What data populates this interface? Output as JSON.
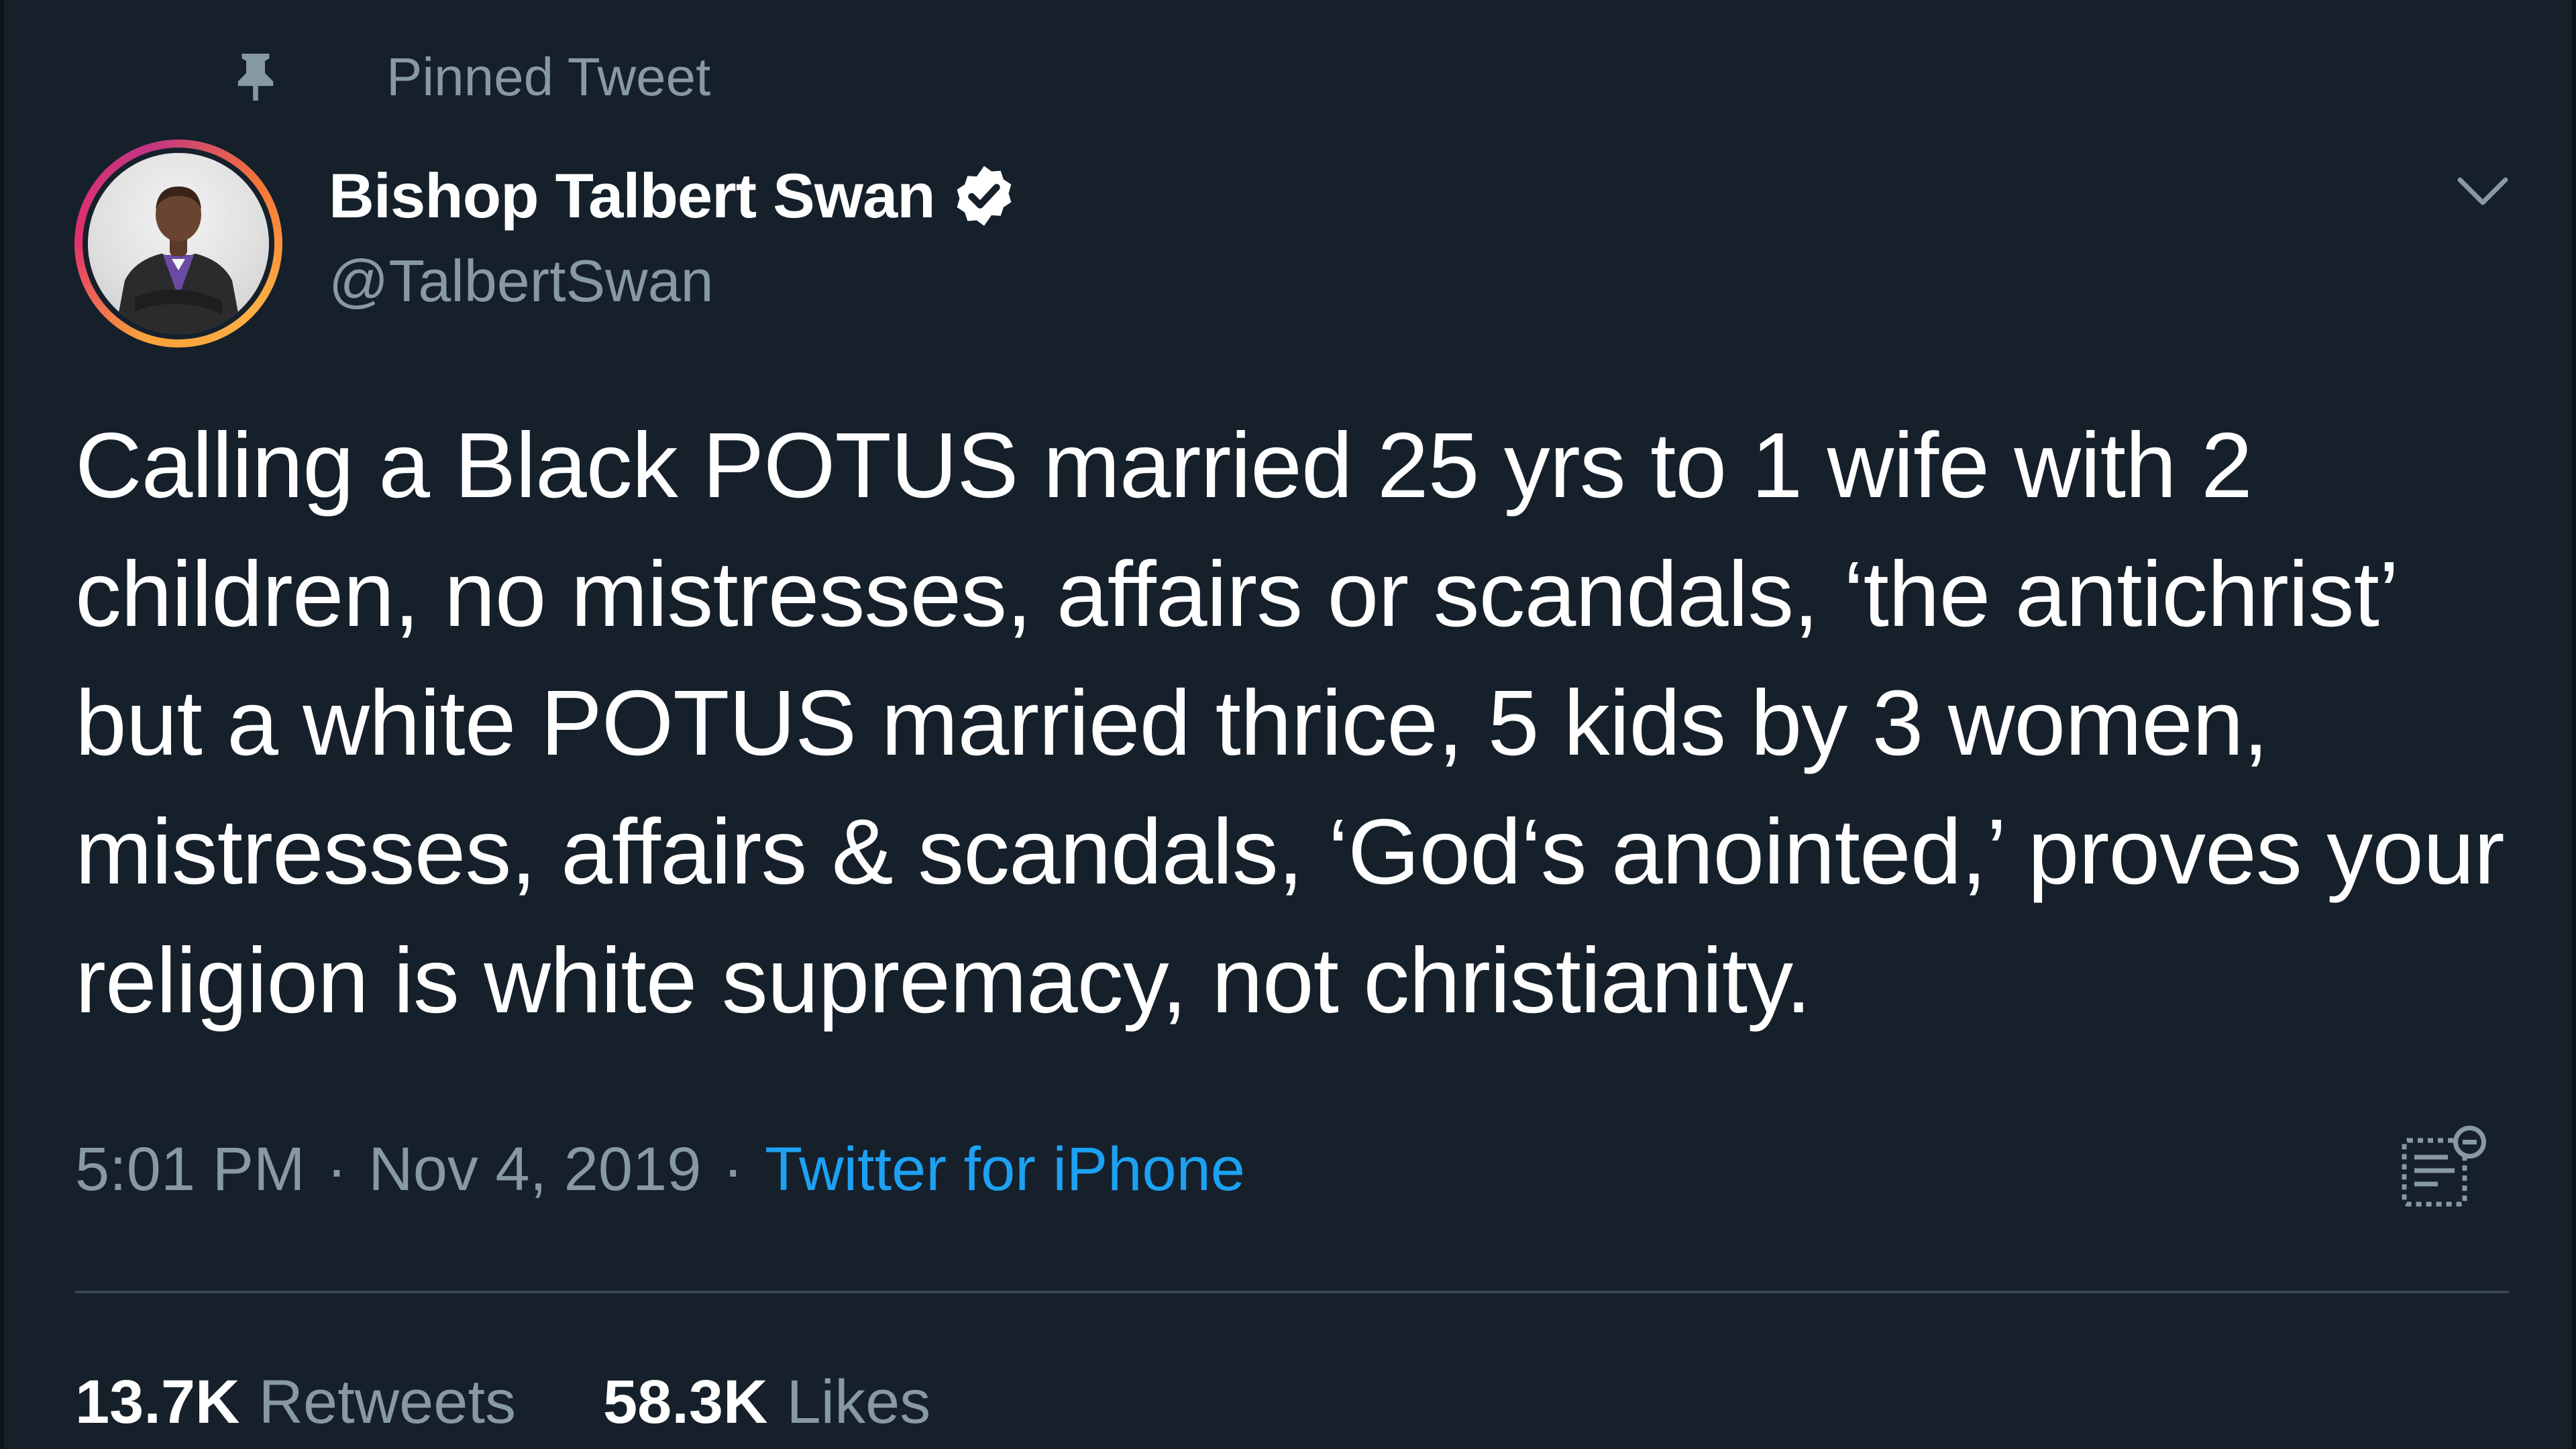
{
  "pinned": {
    "label": "Pinned Tweet",
    "icon": "pin-icon"
  },
  "author": {
    "display_name": "Bishop Talbert Swan",
    "handle": "@TalbertSwan",
    "verified": true,
    "verified_icon": "verified-badge-icon",
    "avatar_ring_colors": [
      "#fcaf45",
      "#e1306c",
      "#c13584"
    ]
  },
  "menu": {
    "icon": "chevron-down-icon"
  },
  "tweet": {
    "text": "Calling a Black POTUS married 25 yrs to 1 wife with 2 children, no mistresses, affairs or scandals, ‘the antichrist’ but a white POTUS married thrice, 5 kids by 3 women, mistresses, affairs & scandals, ‘God‘s anointed,’ proves your religion is white supremacy, not christianity.",
    "time": "5:01 PM",
    "separator": "·",
    "date": "Nov 4, 2019",
    "source": "Twitter for iPhone",
    "analytics_icon": "analytics-icon"
  },
  "stats": {
    "retweets_count": "13.7K",
    "retweets_label": "Retweets",
    "likes_count": "58.3K",
    "likes_label": "Likes"
  },
  "colors": {
    "background": "#15202b",
    "primary_text": "#ffffff",
    "secondary_text": "#8899a6",
    "link": "#1da1f2",
    "divider": "#38444d"
  }
}
